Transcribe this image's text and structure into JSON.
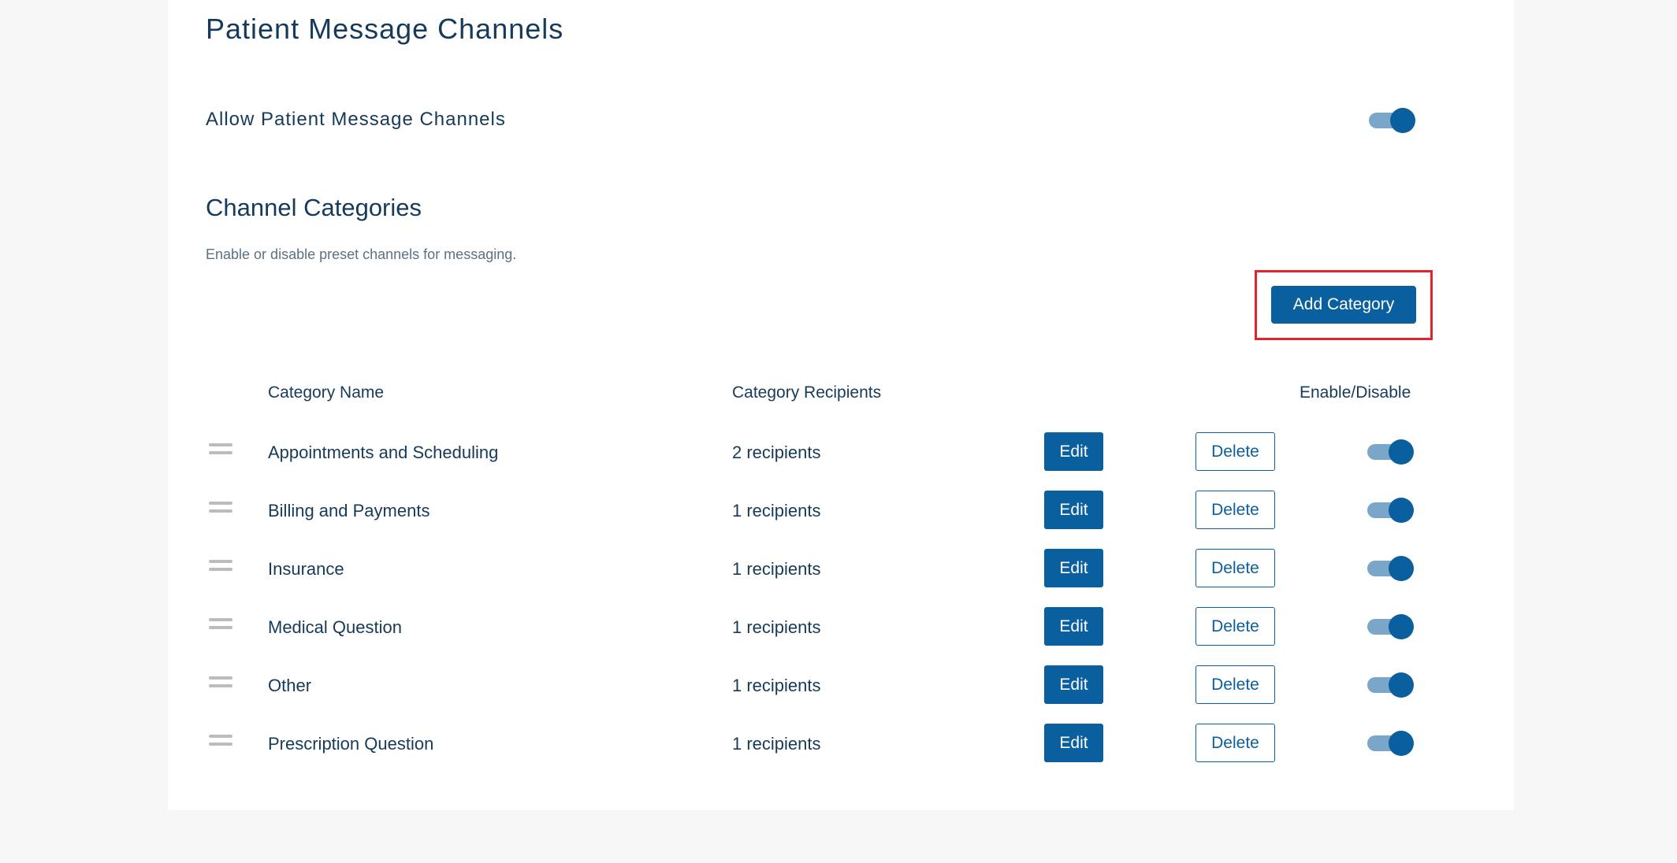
{
  "page": {
    "title": "Patient Message Channels",
    "allow_label": "Allow Patient Message Channels",
    "allow_enabled": true
  },
  "section": {
    "title": "Channel Categories",
    "description": "Enable or disable preset channels for messaging.",
    "add_button_label": "Add Category"
  },
  "table": {
    "headers": {
      "name": "Category Name",
      "recipients": "Category Recipients",
      "enable": "Enable/Disable"
    },
    "rows": [
      {
        "name": "Appointments and Scheduling",
        "recipients": "2 recipients",
        "edit": "Edit",
        "delete": "Delete",
        "enabled": true
      },
      {
        "name": "Billing and Payments",
        "recipients": "1 recipients",
        "edit": "Edit",
        "delete": "Delete",
        "enabled": true
      },
      {
        "name": "Insurance",
        "recipients": "1 recipients",
        "edit": "Edit",
        "delete": "Delete",
        "enabled": true
      },
      {
        "name": "Medical Question",
        "recipients": "1 recipients",
        "edit": "Edit",
        "delete": "Delete",
        "enabled": true
      },
      {
        "name": "Other",
        "recipients": "1 recipients",
        "edit": "Edit",
        "delete": "Delete",
        "enabled": true
      },
      {
        "name": "Prescription Question",
        "recipients": "1 recipients",
        "edit": "Edit",
        "delete": "Delete",
        "enabled": true
      }
    ]
  },
  "colors": {
    "primary": "#0a5f9e",
    "toggle_track": "#7aa7c9",
    "highlight": "#e0242e",
    "text": "#163a5a"
  },
  "icons": {
    "drag_handle": "drag-handle-icon"
  }
}
